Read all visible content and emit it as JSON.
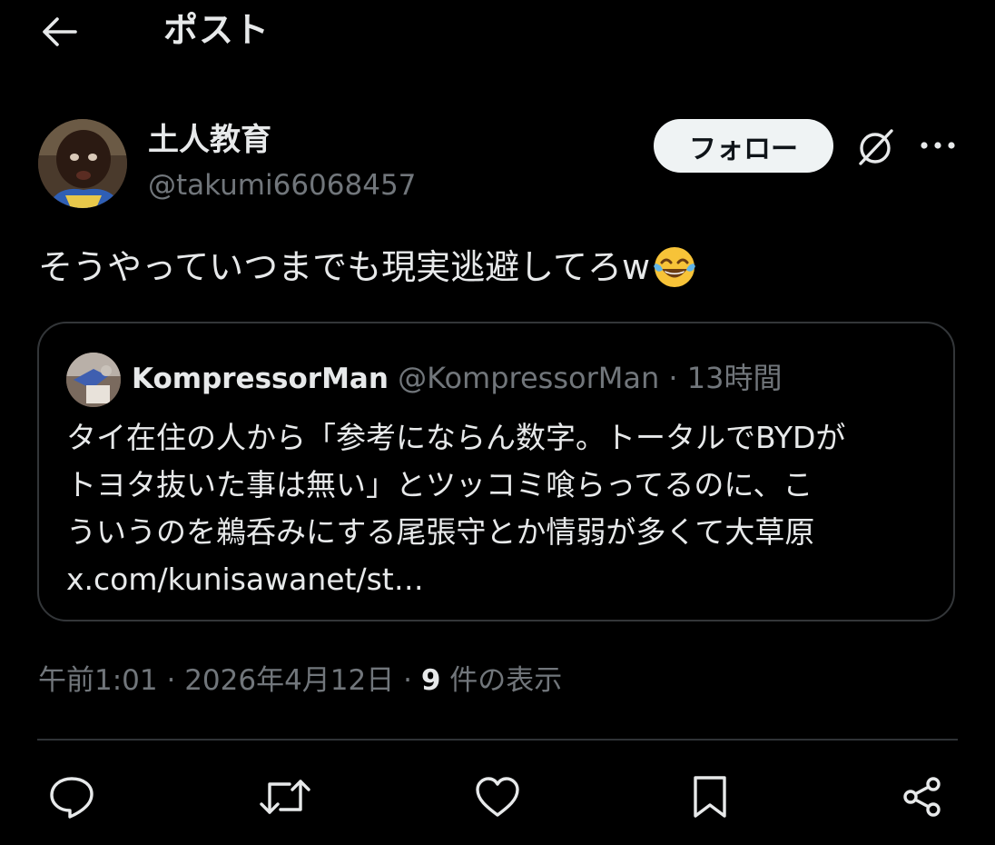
{
  "header": {
    "back_icon": "arrow-left-icon",
    "title": "ポスト"
  },
  "author": {
    "name": "土人教育",
    "handle": "@takumi66068457",
    "follow_label": "フォロー",
    "grok_icon": "grok-icon",
    "more_icon": "more-horizontal-icon"
  },
  "post": {
    "text": "そうやっていつまでも現実逃避してろw",
    "emoji": "face-with-tears-of-joy"
  },
  "quote": {
    "name": "KompressorMan",
    "handle": "@KompressorMan",
    "separator": "·",
    "time": "13時間",
    "lines": [
      "タイ在住の人から「参考にならん数字。トータルでBYDが",
      "トヨタ抜いた事は無い」とツッコミ喰らってるのに、こ",
      "ういうのを鵜呑みにする尾張守とか情弱が多くて大草原",
      "x.com/kunisawanet/st…"
    ]
  },
  "meta": {
    "time": "午前1:01",
    "sep1": " · ",
    "date": "2026年4月12日",
    "sep2": " · ",
    "views_count": "9",
    "views_label": " 件の表示"
  },
  "actions": [
    {
      "icon": "reply-icon"
    },
    {
      "icon": "repost-icon"
    },
    {
      "icon": "like-icon"
    },
    {
      "icon": "bookmark-icon"
    },
    {
      "icon": "share-icon"
    }
  ],
  "colors": {
    "background": "#000000",
    "text_primary": "#e7e9ea",
    "text_secondary": "#71767b",
    "border": "#333639",
    "follow_bg": "#eff3f4"
  }
}
